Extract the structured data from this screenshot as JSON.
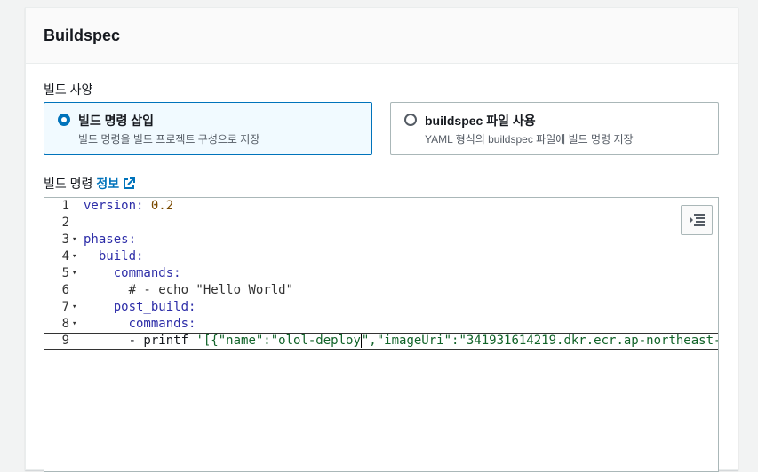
{
  "panel": {
    "title": "Buildspec"
  },
  "build_spec": {
    "label": "빌드 사양",
    "options": [
      {
        "title": "빌드 명령 삽입",
        "description": "빌드 명령을 빌드 프로젝트 구성으로 저장",
        "selected": true
      },
      {
        "title": "buildspec 파일 사용",
        "description": "YAML 형식의 buildspec 파일에 빌드 명령 저장",
        "selected": false
      }
    ]
  },
  "build_commands": {
    "label": "빌드 명령",
    "info_link": "정보",
    "info_icon": "external-link-icon",
    "editor_button_icon": "format-indent-icon",
    "lines": [
      {
        "num": "1",
        "fold": "",
        "tokens": [
          [
            "k",
            "version:"
          ],
          [
            "t",
            " "
          ],
          [
            "n",
            "0.2"
          ]
        ]
      },
      {
        "num": "2",
        "fold": "",
        "tokens": []
      },
      {
        "num": "3",
        "fold": "▾",
        "tokens": [
          [
            "k",
            "phases:"
          ]
        ]
      },
      {
        "num": "4",
        "fold": "▾",
        "tokens": [
          [
            "t",
            "  "
          ],
          [
            "k",
            "build:"
          ]
        ]
      },
      {
        "num": "5",
        "fold": "▾",
        "tokens": [
          [
            "t",
            "    "
          ],
          [
            "k",
            "commands:"
          ]
        ]
      },
      {
        "num": "6",
        "fold": "",
        "tokens": [
          [
            "t",
            "      "
          ],
          [
            "c",
            "# - echo \"Hello World\""
          ]
        ]
      },
      {
        "num": "7",
        "fold": "▾",
        "tokens": [
          [
            "t",
            "    "
          ],
          [
            "k",
            "post_build:"
          ]
        ]
      },
      {
        "num": "8",
        "fold": "▾",
        "tokens": [
          [
            "t",
            "      "
          ],
          [
            "k",
            "commands:"
          ]
        ]
      },
      {
        "num": "9",
        "fold": "",
        "active": true,
        "tokens": [
          [
            "t",
            "      - printf "
          ],
          [
            "s",
            "'[{\"name\":\"olol-deploy"
          ],
          [
            "cursor",
            ""
          ],
          [
            "s",
            "\",\"imageUri\":\"341931614219.dkr.ecr.ap-northeast-"
          ]
        ]
      }
    ]
  },
  "colors": {
    "accent": "#0073bb",
    "selected_tile_bg": "#f1faff"
  }
}
